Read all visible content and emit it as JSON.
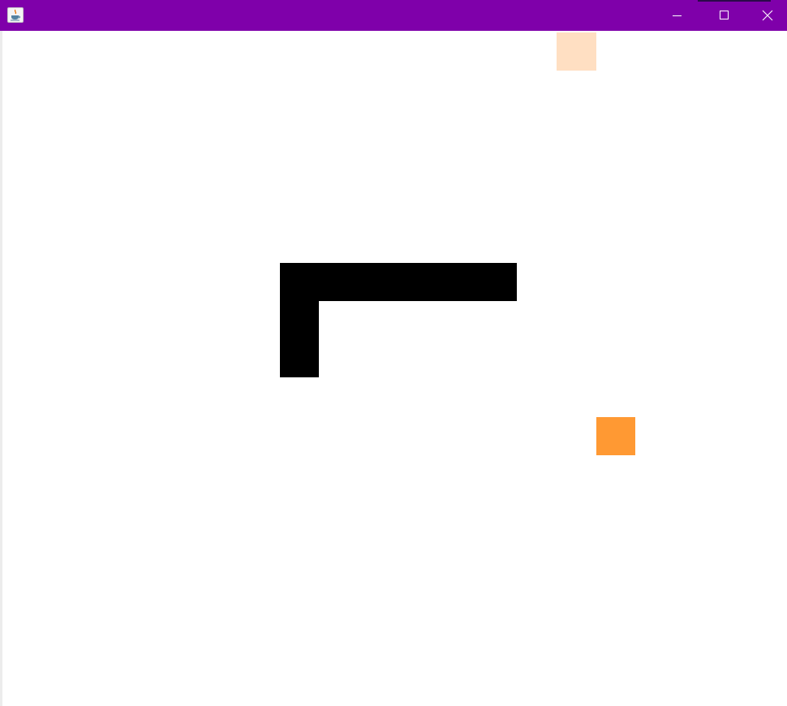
{
  "window": {
    "title": "",
    "titlebar_color": "#7f00aa",
    "icon": "java-coffee-icon",
    "buttons": {
      "minimize_icon": "minimize-icon",
      "maximize_icon": "maximize-icon",
      "close_icon": "close-icon"
    }
  },
  "game": {
    "board_color": "#ffffff",
    "snake_color": "#000000",
    "food_color": "#ff9933",
    "bonus_color": "#ffdfc2",
    "snake_segment_count": 8
  }
}
